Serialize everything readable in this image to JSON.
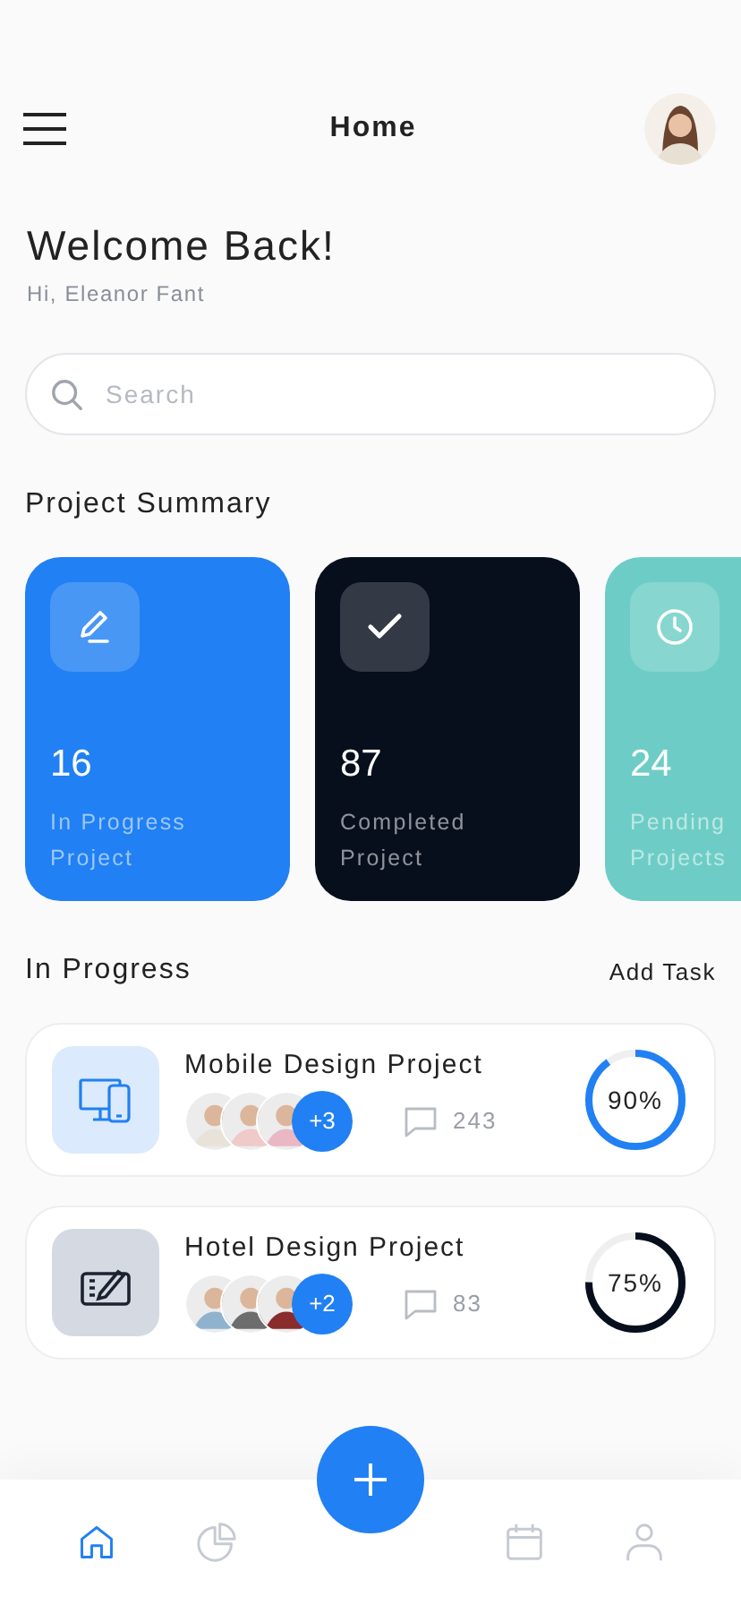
{
  "header": {
    "title": "Home"
  },
  "greeting": {
    "title": "Welcome Back!",
    "subtitle": "Hi, Eleanor Fant"
  },
  "search": {
    "placeholder": "Search"
  },
  "summary": {
    "title": "Project Summary",
    "cards": [
      {
        "kind": "edit",
        "color": "#2180f3",
        "count": "16",
        "label": "In Progress Project"
      },
      {
        "kind": "check",
        "color": "#070f1d",
        "count": "87",
        "label": "Completed Project"
      },
      {
        "kind": "clock",
        "color": "#6dcdc6",
        "count": "24",
        "label": "Pending Projects"
      }
    ]
  },
  "in_progress": {
    "title": "In Progress",
    "action": "Add Task",
    "projects": [
      {
        "kind": "devices",
        "name": "Mobile Design Project",
        "extra_members": "+3",
        "comments": "243",
        "progress": "90%",
        "level": 0.9,
        "color": "#2180f3"
      },
      {
        "kind": "tablet",
        "name": "Hotel Design Project",
        "extra_members": "+2",
        "comments": "83",
        "progress": "75%",
        "level": 0.75,
        "color": "#070f1d"
      }
    ]
  },
  "nav": [
    {
      "kind": "home",
      "selected": true
    },
    {
      "kind": "chart",
      "selected": false
    },
    {
      "kind": "calendar",
      "selected": false
    },
    {
      "kind": "profile",
      "selected": false
    }
  ]
}
